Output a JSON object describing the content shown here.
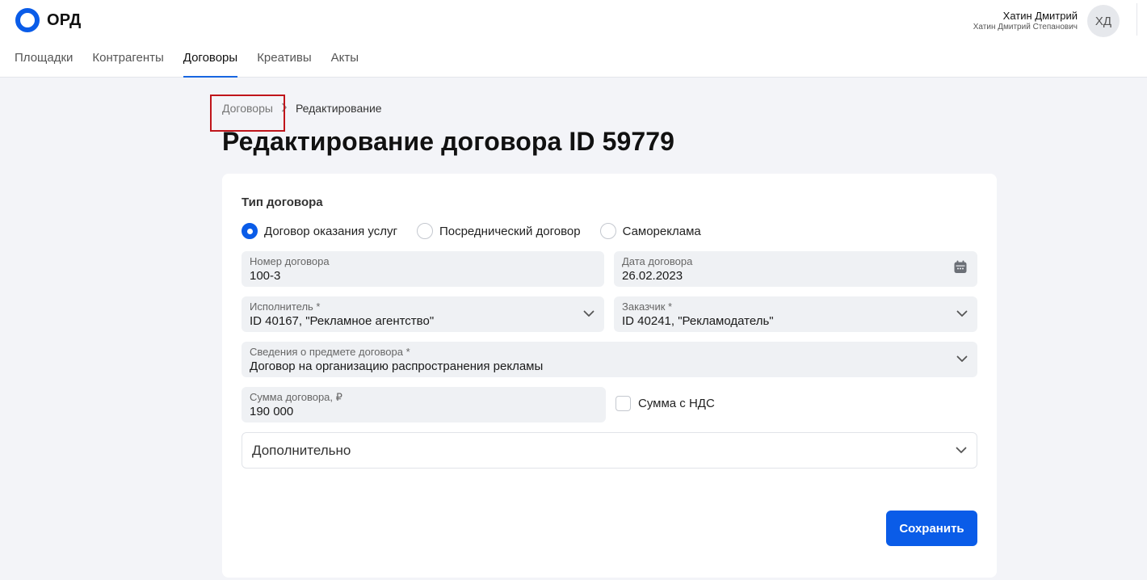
{
  "app": {
    "logo_text": "ОРД",
    "brand_color": "#0a5ce8"
  },
  "user": {
    "name": "Хатин Дмитрий",
    "full_name": "Хатин Дмитрий Степанович",
    "initials": "ХД"
  },
  "nav": {
    "items": [
      {
        "label": "Площадки",
        "active": false
      },
      {
        "label": "Контрагенты",
        "active": false
      },
      {
        "label": "Договоры",
        "active": true
      },
      {
        "label": "Креативы",
        "active": false
      },
      {
        "label": "Акты",
        "active": false
      }
    ]
  },
  "breadcrumb": {
    "parent": "Договоры",
    "current": "Редактирование"
  },
  "page": {
    "title": "Редактирование договора ID 59779"
  },
  "form": {
    "type_section_title": "Тип договора",
    "contract_types": [
      {
        "label": "Договор оказания услуг",
        "selected": true
      },
      {
        "label": "Посреднический договор",
        "selected": false
      },
      {
        "label": "Самореклама",
        "selected": false
      }
    ],
    "contract_number": {
      "label": "Номер договора",
      "value": "100-3"
    },
    "contract_date": {
      "label": "Дата договора",
      "value": "26.02.2023"
    },
    "executor": {
      "label": "Исполнитель *",
      "value": "ID 40167, \"Рекламное агентство\""
    },
    "customer": {
      "label": "Заказчик *",
      "value": "ID 40241, \"Рекламодатель\""
    },
    "subject": {
      "label": "Сведения о предмете договора *",
      "value": "Договор на организацию распространения рекламы"
    },
    "amount": {
      "label": "Сумма договора, ₽",
      "value": "190 000"
    },
    "vat_checkbox": {
      "label": "Сумма с НДС",
      "checked": false
    },
    "additional": {
      "label": "Дополнительно"
    },
    "save_button": "Сохранить"
  },
  "icons": {
    "calendar": "calendar-icon",
    "dropdown": "chevron-down-icon",
    "breadcrumb_separator": "chevron-right-icon"
  }
}
